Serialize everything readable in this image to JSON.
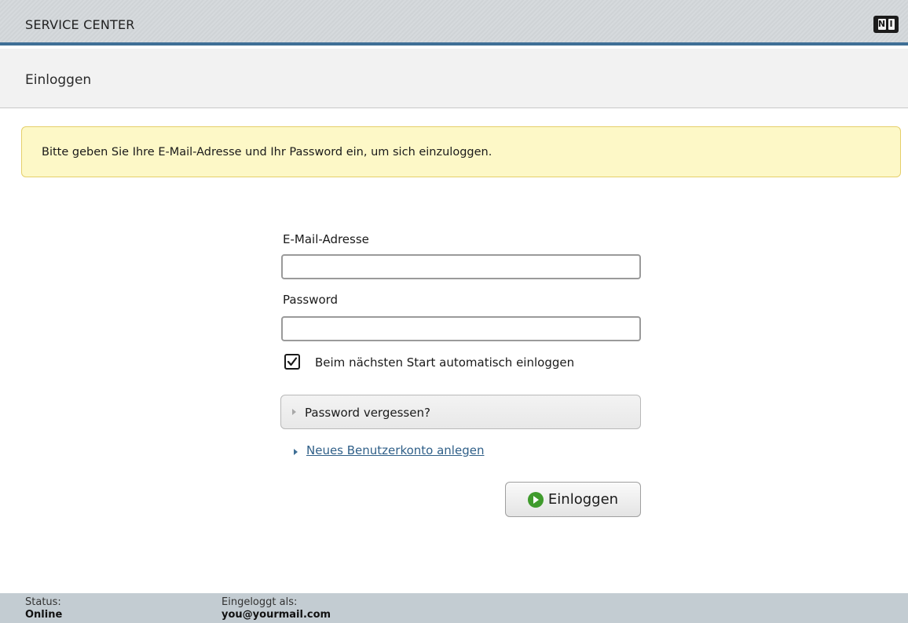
{
  "window": {
    "title": "SERVICE CENTER",
    "logo_icon": "ni-logo-icon"
  },
  "header": {
    "heading": "Einloggen"
  },
  "notice": {
    "text": "Bitte geben Sie Ihre E-Mail-Adresse und Ihr Password ein, um sich einzuloggen."
  },
  "form": {
    "email_label": "E-Mail-Adresse",
    "email_value": "",
    "password_label": "Password",
    "password_value": "",
    "auto_login_label": "Beim nächsten Start automatisch einloggen",
    "auto_login_checked": true,
    "forgot_label": "Password vergessen?",
    "new_account_label": "Neues Benutzerkonto anlegen",
    "login_button_label": "Einloggen"
  },
  "footer": {
    "status_label": "Status:",
    "status_value": "Online",
    "logged_in_label": "Eingeloggt als:",
    "logged_in_value": "you@yourmail.com"
  },
  "colors": {
    "accent_blue": "#3f6f96",
    "notice_bg": "#fdf8c7",
    "footer_bg": "#c3ccd2",
    "play_green": "#3f9b2c"
  }
}
